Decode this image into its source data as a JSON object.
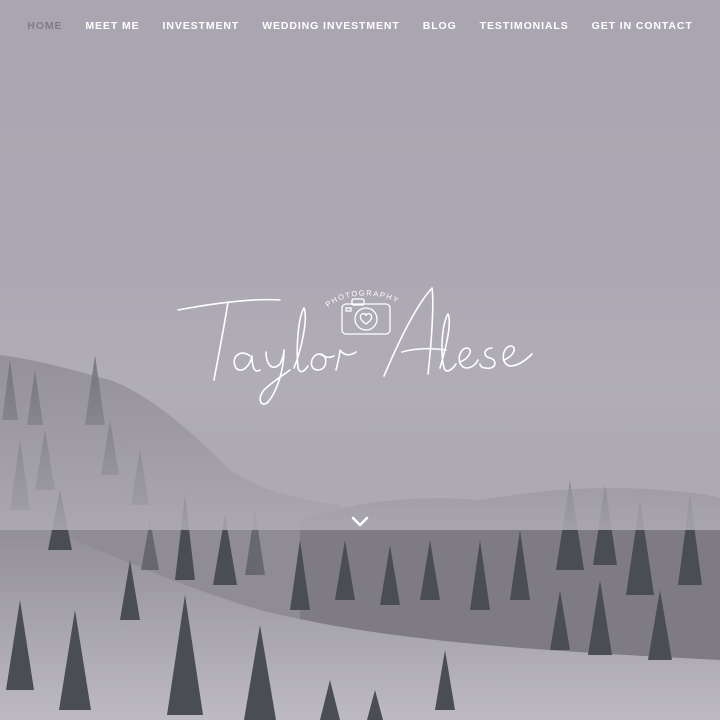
{
  "nav": {
    "items": [
      {
        "label": "HOME",
        "active": true
      },
      {
        "label": "MEET ME",
        "active": false
      },
      {
        "label": "INVESTMENT",
        "active": false
      },
      {
        "label": "WEDDING INVESTMENT",
        "active": false
      },
      {
        "label": "BLOG",
        "active": false
      },
      {
        "label": "TESTIMONIALS",
        "active": false
      },
      {
        "label": "GET IN CONTACT",
        "active": false
      }
    ]
  },
  "logo": {
    "name": "Taylor Alese",
    "tagline": "PHOTOGRAPHY",
    "icon": "camera-heart-icon"
  },
  "scroll": {
    "icon": "chevron-down-icon"
  },
  "colors": {
    "sky": "#aaa6b1",
    "nav_text": "#ffffff",
    "nav_active": "#7f7c84",
    "forest_dark": "#3f4349",
    "snow": "#c9c6cc"
  }
}
